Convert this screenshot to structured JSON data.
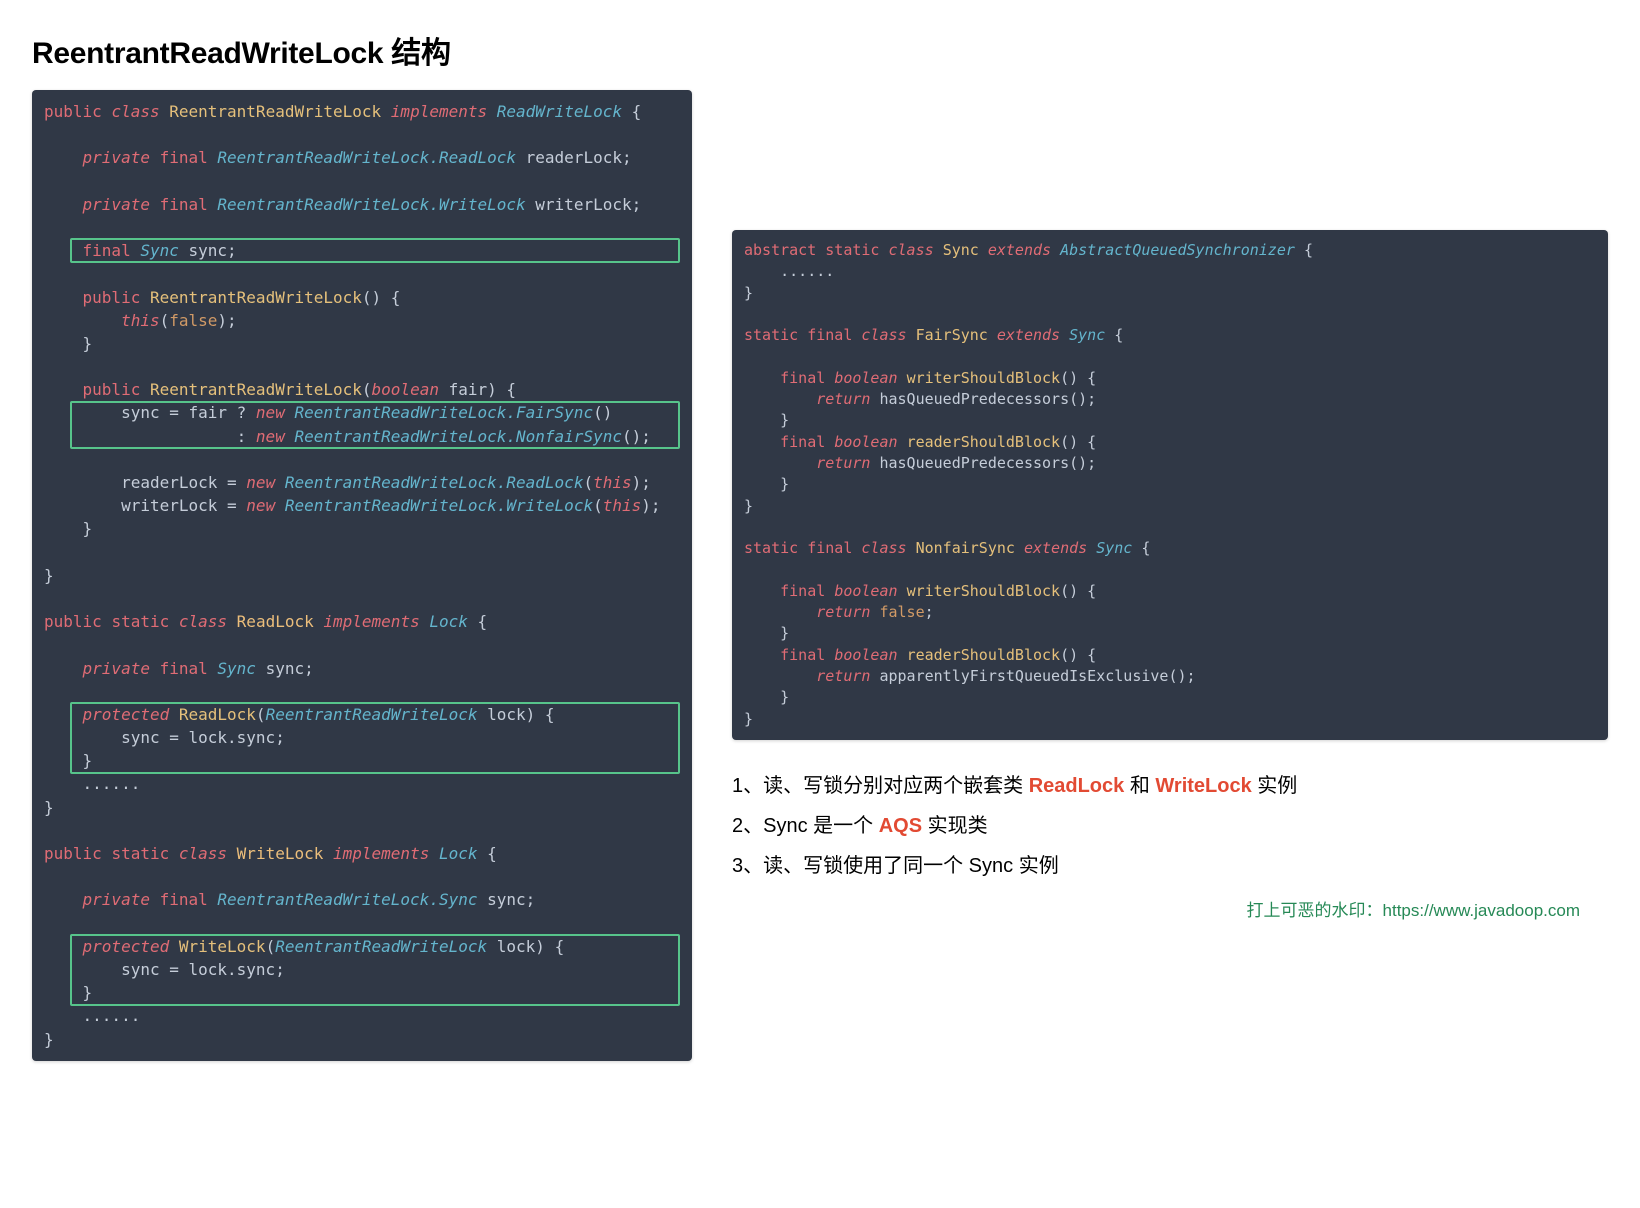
{
  "title": "ReentrantReadWriteLock 结构",
  "code_left": {
    "tokens": [
      [
        [
          "public ",
          "kw"
        ],
        [
          "class ",
          "kw2"
        ],
        [
          "ReentrantReadWriteLock ",
          "nm"
        ],
        [
          "implements ",
          "kw2"
        ],
        [
          "ReadWriteLock ",
          "typ"
        ],
        [
          "{",
          "id"
        ]
      ],
      [],
      [
        [
          "    ",
          "id"
        ],
        [
          "private ",
          "kw2"
        ],
        [
          "final ",
          "kw"
        ],
        [
          "ReentrantReadWriteLock.ReadLock ",
          "typ"
        ],
        [
          "readerLock;",
          "id"
        ]
      ],
      [],
      [
        [
          "    ",
          "id"
        ],
        [
          "private ",
          "kw2"
        ],
        [
          "final ",
          "kw"
        ],
        [
          "ReentrantReadWriteLock.WriteLock ",
          "typ"
        ],
        [
          "writerLock;",
          "id"
        ]
      ],
      [],
      [
        [
          "    ",
          "id"
        ],
        [
          "final ",
          "kw"
        ],
        [
          "Sync ",
          "typ"
        ],
        [
          "sync;",
          "id"
        ]
      ],
      [],
      [
        [
          "    ",
          "id"
        ],
        [
          "public ",
          "kw"
        ],
        [
          "ReentrantReadWriteLock",
          "nm"
        ],
        [
          "() {",
          "id"
        ]
      ],
      [
        [
          "        ",
          "id"
        ],
        [
          "this",
          "kw2"
        ],
        [
          "(",
          "id"
        ],
        [
          "false",
          "lit"
        ],
        [
          ");",
          "id"
        ]
      ],
      [
        [
          "    }",
          "id"
        ]
      ],
      [],
      [
        [
          "    ",
          "id"
        ],
        [
          "public ",
          "kw"
        ],
        [
          "ReentrantReadWriteLock",
          "nm"
        ],
        [
          "(",
          "id"
        ],
        [
          "boolean ",
          "kw2"
        ],
        [
          "fair) {",
          "id"
        ]
      ],
      [
        [
          "        sync = fair ? ",
          "id"
        ],
        [
          "new ",
          "kw2"
        ],
        [
          "ReentrantReadWriteLock.FairSync",
          "typ"
        ],
        [
          "()",
          "id"
        ]
      ],
      [
        [
          "                    : ",
          "id"
        ],
        [
          "new ",
          "kw2"
        ],
        [
          "ReentrantReadWriteLock.NonfairSync",
          "typ"
        ],
        [
          "();",
          "id"
        ]
      ],
      [],
      [
        [
          "        readerLock = ",
          "id"
        ],
        [
          "new ",
          "kw2"
        ],
        [
          "ReentrantReadWriteLock.ReadLock",
          "typ"
        ],
        [
          "(",
          "id"
        ],
        [
          "this",
          "kw2"
        ],
        [
          ");",
          "id"
        ]
      ],
      [
        [
          "        writerLock = ",
          "id"
        ],
        [
          "new ",
          "kw2"
        ],
        [
          "ReentrantReadWriteLock.WriteLock",
          "typ"
        ],
        [
          "(",
          "id"
        ],
        [
          "this",
          "kw2"
        ],
        [
          ");",
          "id"
        ]
      ],
      [
        [
          "    }",
          "id"
        ]
      ],
      [],
      [
        [
          "}",
          "id"
        ]
      ],
      [],
      [
        [
          "public ",
          "kw"
        ],
        [
          "static ",
          "kw"
        ],
        [
          "class ",
          "kw2"
        ],
        [
          "ReadLock ",
          "cls"
        ],
        [
          "implements ",
          "kw2"
        ],
        [
          "Lock ",
          "typ"
        ],
        [
          "{",
          "id"
        ]
      ],
      [],
      [
        [
          "    ",
          "id"
        ],
        [
          "private ",
          "kw2"
        ],
        [
          "final ",
          "kw"
        ],
        [
          "Sync ",
          "typ"
        ],
        [
          "sync;",
          "id"
        ]
      ],
      [],
      [
        [
          "    ",
          "id"
        ],
        [
          "protected ",
          "kw2"
        ],
        [
          "ReadLock",
          "nm"
        ],
        [
          "(",
          "id"
        ],
        [
          "ReentrantReadWriteLock ",
          "typ"
        ],
        [
          "lock) {",
          "id"
        ]
      ],
      [
        [
          "        sync = lock.sync;",
          "id"
        ]
      ],
      [
        [
          "    }",
          "id"
        ]
      ],
      [
        [
          "    ......",
          "id"
        ]
      ],
      [
        [
          "}",
          "id"
        ]
      ],
      [],
      [
        [
          "public ",
          "kw"
        ],
        [
          "static ",
          "kw"
        ],
        [
          "class ",
          "kw2"
        ],
        [
          "WriteLock ",
          "cls"
        ],
        [
          "implements ",
          "kw2"
        ],
        [
          "Lock ",
          "typ"
        ],
        [
          "{",
          "id"
        ]
      ],
      [],
      [
        [
          "    ",
          "id"
        ],
        [
          "private ",
          "kw2"
        ],
        [
          "final ",
          "kw"
        ],
        [
          "ReentrantReadWriteLock.Sync ",
          "typ"
        ],
        [
          "sync;",
          "id"
        ]
      ],
      [],
      [
        [
          "    ",
          "id"
        ],
        [
          "protected ",
          "kw2"
        ],
        [
          "WriteLock",
          "nm"
        ],
        [
          "(",
          "id"
        ],
        [
          "ReentrantReadWriteLock ",
          "typ"
        ],
        [
          "lock) {",
          "id"
        ]
      ],
      [
        [
          "        sync = lock.sync;",
          "id"
        ]
      ],
      [
        [
          "    }",
          "id"
        ]
      ],
      [
        [
          "    ......",
          "id"
        ]
      ],
      [
        [
          "}",
          "id"
        ]
      ]
    ],
    "highlights": [
      {
        "from": 6,
        "to": 6
      },
      {
        "from": 13,
        "to": 14
      },
      {
        "from": 26,
        "to": 28
      },
      {
        "from": 36,
        "to": 38
      }
    ]
  },
  "code_right": {
    "tokens": [
      [
        [
          "abstract ",
          "kw"
        ],
        [
          "static ",
          "kw"
        ],
        [
          "class ",
          "kw2"
        ],
        [
          "Sync ",
          "nm"
        ],
        [
          "extends ",
          "kw2"
        ],
        [
          "AbstractQueuedSynchronizer ",
          "typ"
        ],
        [
          "{",
          "id"
        ]
      ],
      [
        [
          "    ......",
          "id"
        ]
      ],
      [
        [
          "}",
          "id"
        ]
      ],
      [],
      [
        [
          "static ",
          "kw"
        ],
        [
          "final ",
          "kw"
        ],
        [
          "class ",
          "kw2"
        ],
        [
          "FairSync ",
          "nm"
        ],
        [
          "extends ",
          "kw2"
        ],
        [
          "Sync ",
          "typ"
        ],
        [
          "{",
          "id"
        ]
      ],
      [],
      [
        [
          "    ",
          "id"
        ],
        [
          "final ",
          "kw"
        ],
        [
          "boolean ",
          "kw2"
        ],
        [
          "writerShouldBlock",
          "nm"
        ],
        [
          "() {",
          "id"
        ]
      ],
      [
        [
          "        ",
          "id"
        ],
        [
          "return ",
          "kw2"
        ],
        [
          "hasQueuedPredecessors();",
          "id"
        ]
      ],
      [
        [
          "    }",
          "id"
        ]
      ],
      [
        [
          "    ",
          "id"
        ],
        [
          "final ",
          "kw"
        ],
        [
          "boolean ",
          "kw2"
        ],
        [
          "readerShouldBlock",
          "nm"
        ],
        [
          "() {",
          "id"
        ]
      ],
      [
        [
          "        ",
          "id"
        ],
        [
          "return ",
          "kw2"
        ],
        [
          "hasQueuedPredecessors();",
          "id"
        ]
      ],
      [
        [
          "    }",
          "id"
        ]
      ],
      [
        [
          "}",
          "id"
        ]
      ],
      [],
      [
        [
          "static ",
          "kw"
        ],
        [
          "final ",
          "kw"
        ],
        [
          "class ",
          "kw2"
        ],
        [
          "NonfairSync ",
          "nm"
        ],
        [
          "extends ",
          "kw2"
        ],
        [
          "Sync ",
          "typ"
        ],
        [
          "{",
          "id"
        ]
      ],
      [],
      [
        [
          "    ",
          "id"
        ],
        [
          "final ",
          "kw"
        ],
        [
          "boolean ",
          "kw2"
        ],
        [
          "writerShouldBlock",
          "nm"
        ],
        [
          "() {",
          "id"
        ]
      ],
      [
        [
          "        ",
          "id"
        ],
        [
          "return ",
          "kw2"
        ],
        [
          "false",
          "lit"
        ],
        [
          ";",
          "id"
        ]
      ],
      [
        [
          "    }",
          "id"
        ]
      ],
      [
        [
          "    ",
          "id"
        ],
        [
          "final ",
          "kw"
        ],
        [
          "boolean ",
          "kw2"
        ],
        [
          "readerShouldBlock",
          "nm"
        ],
        [
          "() {",
          "id"
        ]
      ],
      [
        [
          "        ",
          "id"
        ],
        [
          "return ",
          "kw2"
        ],
        [
          "apparentlyFirstQueuedIsExclusive();",
          "id"
        ]
      ],
      [
        [
          "    }",
          "id"
        ]
      ],
      [
        [
          "}",
          "id"
        ]
      ]
    ]
  },
  "notes": [
    [
      {
        "text": "1、读、写锁分别对应两个嵌套类 ",
        "cls": ""
      },
      {
        "text": "ReadLock",
        "cls": "accent"
      },
      {
        "text": " 和 ",
        "cls": ""
      },
      {
        "text": "WriteLock",
        "cls": "accent"
      },
      {
        "text": " 实例",
        "cls": ""
      }
    ],
    [
      {
        "text": "2、Sync 是一个 ",
        "cls": ""
      },
      {
        "text": "AQS",
        "cls": "accent"
      },
      {
        "text": " 实现类",
        "cls": ""
      }
    ],
    [
      {
        "text": "3、读、写锁使用了同一个 Sync 实例",
        "cls": ""
      }
    ]
  ],
  "watermark": "打上可恶的水印：https://www.javadoop.com"
}
